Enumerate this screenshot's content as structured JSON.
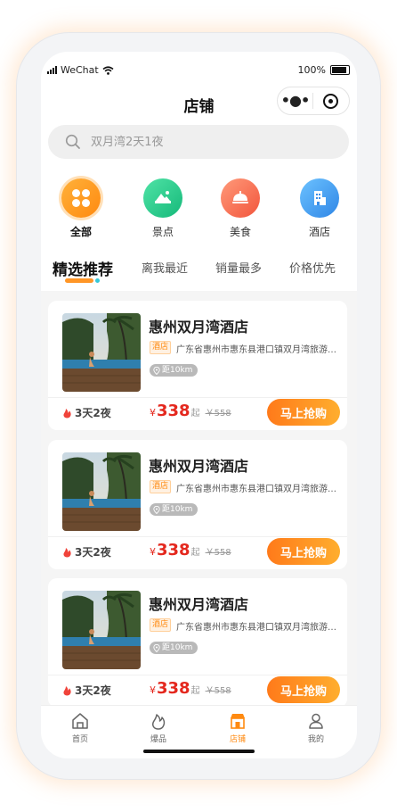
{
  "status_bar": {
    "carrier": "WeChat",
    "battery": "100%"
  },
  "nav": {
    "title": "店铺"
  },
  "search": {
    "placeholder": "双月湾2天1夜"
  },
  "categories": [
    {
      "label": "全部",
      "icon": "grid-icon",
      "active": true
    },
    {
      "label": "景点",
      "icon": "mountain-icon"
    },
    {
      "label": "美食",
      "icon": "dish-icon"
    },
    {
      "label": "酒店",
      "icon": "hotel-icon"
    }
  ],
  "tabs": [
    {
      "label": "精选推荐",
      "active": true
    },
    {
      "label": "离我最近"
    },
    {
      "label": "销量最多"
    },
    {
      "label": "价格优先"
    }
  ],
  "products": [
    {
      "name": "惠州双月湾酒店",
      "tag": "酒店",
      "address": "广东省惠州市惠东县港口镇双月湾旅游度假区",
      "distance": "距10km",
      "duration": "3天2夜",
      "currency": "¥",
      "price": "338",
      "price_suffix": "起",
      "original_price": "￥558",
      "button": "马上抢购"
    },
    {
      "name": "惠州双月湾酒店",
      "tag": "酒店",
      "address": "广东省惠州市惠东县港口镇双月湾旅游度假区",
      "distance": "距10km",
      "duration": "3天2夜",
      "currency": "¥",
      "price": "338",
      "price_suffix": "起",
      "original_price": "￥558",
      "button": "马上抢购"
    },
    {
      "name": "惠州双月湾酒店",
      "tag": "酒店",
      "address": "广东省惠州市惠东县港口镇双月湾旅游度假区",
      "distance": "距10km",
      "duration": "3天2夜",
      "currency": "¥",
      "price": "338",
      "price_suffix": "起",
      "original_price": "￥558",
      "button": "马上抢购"
    }
  ],
  "tabbar": [
    {
      "label": "首页",
      "icon": "home-icon"
    },
    {
      "label": "爆品",
      "icon": "flame-icon"
    },
    {
      "label": "店铺",
      "icon": "shop-icon",
      "active": true
    },
    {
      "label": "我的",
      "icon": "user-icon"
    }
  ],
  "colors": {
    "accent": "#ff8a10",
    "price": "#e4281e",
    "tab_indicator": "#ff9626"
  }
}
